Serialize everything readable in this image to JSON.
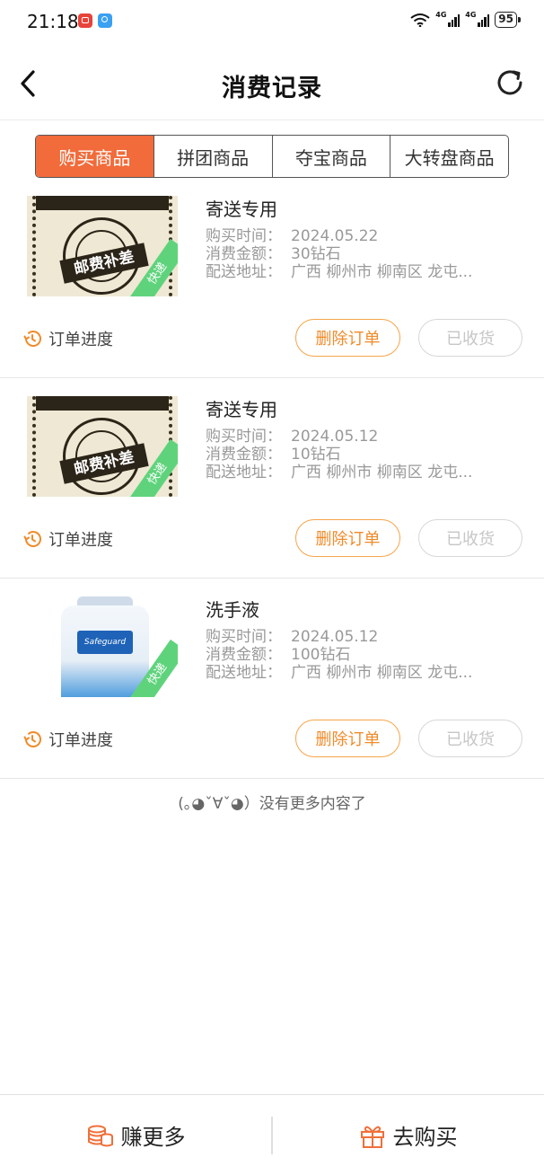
{
  "status_bar": {
    "time": "21:18",
    "network_1": "4G",
    "network_2": "4G",
    "battery": "95"
  },
  "header": {
    "title": "消费记录"
  },
  "tabs": [
    {
      "label": "购买商品",
      "active": true
    },
    {
      "label": "拼团商品",
      "active": false
    },
    {
      "label": "夺宝商品",
      "active": false
    },
    {
      "label": "大转盘商品",
      "active": false
    }
  ],
  "labels": {
    "time_key": "购买时间：",
    "amount_key": "消费金额：",
    "address_key": "配送地址：",
    "progress": "订单进度",
    "delete": "删除订单",
    "received": "已收货",
    "badge": "快递",
    "stamp_text": "邮费补差"
  },
  "orders": [
    {
      "name": "寄送专用",
      "time": "2024.05.22",
      "amount": "30钻石",
      "address": "广西 柳州市 柳南区 龙屯..."
    },
    {
      "name": "寄送专用",
      "time": "2024.05.12",
      "amount": "10钻石",
      "address": "广西 柳州市 柳南区 龙屯..."
    },
    {
      "name": "洗手液",
      "time": "2024.05.12",
      "amount": "100钻石",
      "address": "广西 柳州市 柳南区 龙屯..."
    }
  ],
  "no_more": "(｡◕ˇ∀ˇ◕）没有更多内容了",
  "bottom": {
    "earn_more": "赚更多",
    "go_buy": "去购买"
  },
  "colors": {
    "accent": "#f26b3a",
    "button_orange": "#f08b2a",
    "badge_green": "#5fd37c"
  }
}
